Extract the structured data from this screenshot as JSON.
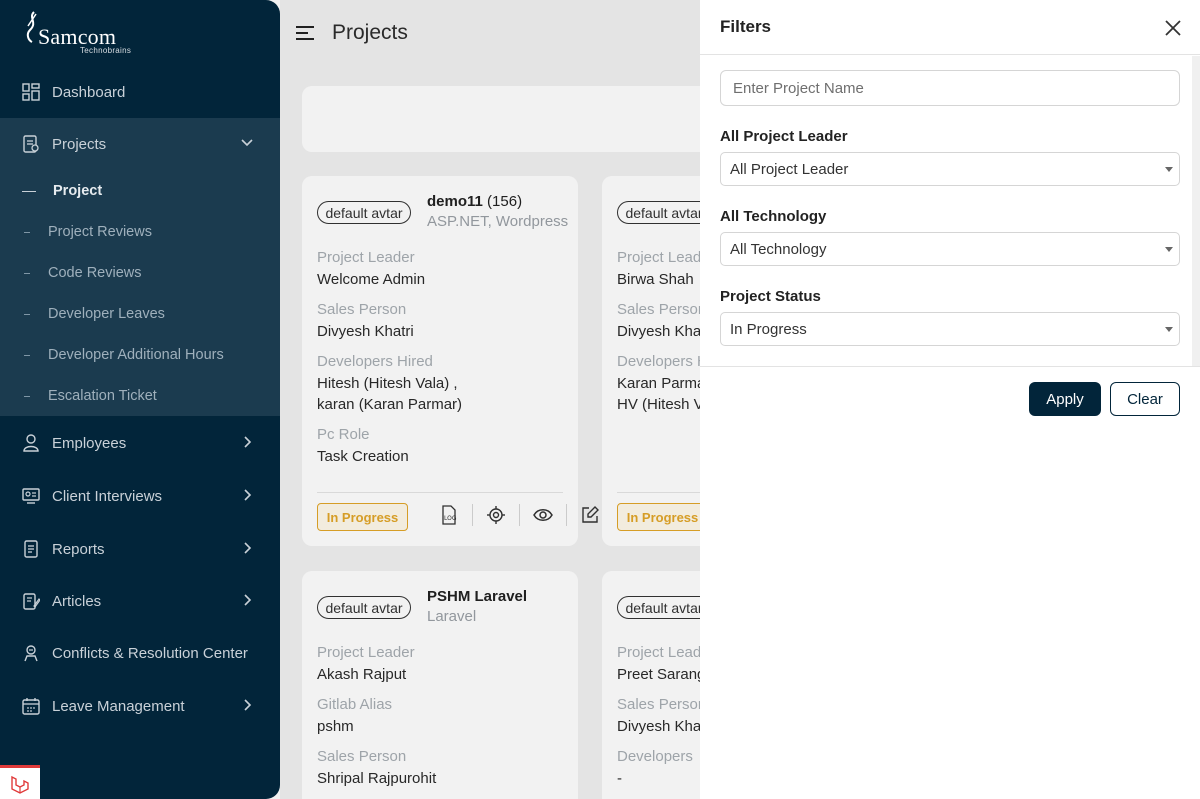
{
  "logo": {
    "brand": "Samcom",
    "tagline": "Technobrains"
  },
  "sidebar": {
    "dashboard": "Dashboard",
    "projects": "Projects",
    "sub_items": [
      "Project",
      "Project Reviews",
      "Code Reviews",
      "Developer Leaves",
      "Developer Additional Hours",
      "Escalation Ticket"
    ],
    "employees": "Employees",
    "client_interviews": "Client Interviews",
    "reports": "Reports",
    "articles": "Articles",
    "conflicts": "Conflicts & Resolution Center",
    "leave_management": "Leave Management"
  },
  "header": {
    "title": "Projects"
  },
  "cards": [
    {
      "avatar_alt": "default avtar",
      "name": "demo11",
      "count": "(156)",
      "tech": "ASP.NET, Wordpress",
      "fields": [
        {
          "label": "Project Leader",
          "value": "Welcome Admin"
        },
        {
          "label": "Sales Person",
          "value": "Divyesh Khatri"
        },
        {
          "label": "Developers Hired",
          "value": "Hitesh (Hitesh Vala) ,",
          "value2": "karan (Karan Parmar)"
        },
        {
          "label": "Pc Role",
          "value": "Task Creation"
        }
      ],
      "status": "In Progress"
    },
    {
      "avatar_alt": "default avtar",
      "fields": [
        {
          "label": "Project Leader",
          "value": "Birwa Shah"
        },
        {
          "label": "Sales Person",
          "value": "Divyesh Khatri"
        },
        {
          "label": "Developers Hired",
          "value": "Karan Parmar",
          "value2": "HV (Hitesh Vala)"
        }
      ],
      "status": "In Progress"
    },
    {
      "avatar_alt": "default avtar",
      "name": "PSHM Laravel",
      "tech": "Laravel",
      "fields": [
        {
          "label": "Project Leader",
          "value": "Akash Rajput"
        },
        {
          "label": "Gitlab Alias",
          "value": "pshm"
        },
        {
          "label": "Sales Person",
          "value": "Shripal Rajpurohit"
        }
      ]
    },
    {
      "avatar_alt": "default avtar",
      "fields": [
        {
          "label": "Project Leader",
          "value": "Preet Sarang"
        },
        {
          "label": "Sales Person",
          "value": "Divyesh Khatri"
        },
        {
          "label": "Developers",
          "value": "-"
        }
      ]
    }
  ],
  "filters": {
    "title": "Filters",
    "project_name_placeholder": "Enter Project Name",
    "leader_label": "All Project Leader",
    "leader_value": "All Project Leader",
    "tech_label": "All Technology",
    "tech_value": "All Technology",
    "status_label": "Project Status",
    "status_value": "In Progress",
    "apply": "Apply",
    "clear": "Clear"
  },
  "colors": {
    "sidebar_bg": "#02253a",
    "status_amber": "#e2a629",
    "primary": "#02253a"
  }
}
